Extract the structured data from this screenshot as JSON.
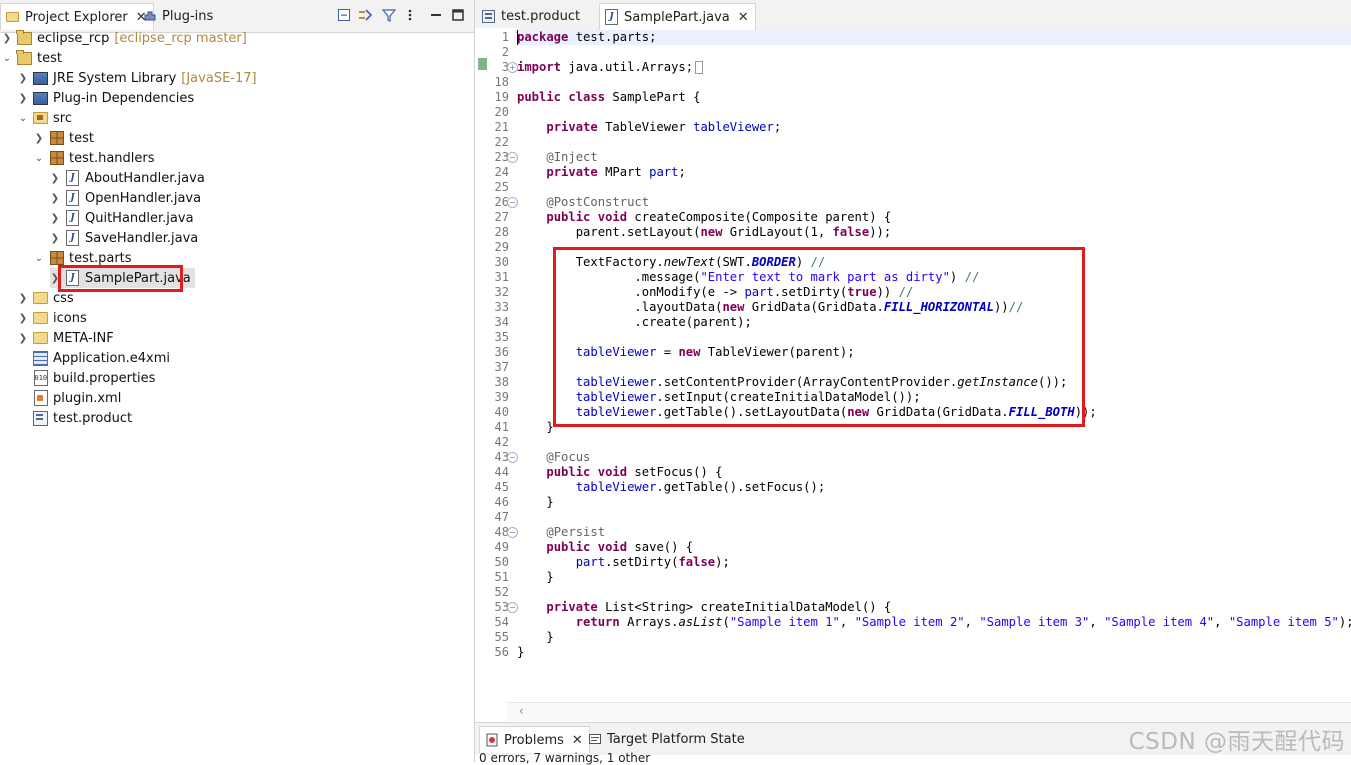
{
  "left_view": {
    "tabs": [
      {
        "label": "Project Explorer",
        "close": "✕"
      },
      {
        "label": "Plug-ins"
      }
    ],
    "toolbar_icons": [
      "collapse-all-icon",
      "link-with-editor-icon",
      "filter-icon",
      "view-menu-icon",
      "minimize-icon",
      "maximize-icon"
    ],
    "tree": [
      {
        "label": "eclipse_rcp",
        "deco": "[eclipse_rcp master]"
      },
      {
        "label": "test"
      },
      {
        "label": "JRE System Library",
        "deco": "[JavaSE-17]"
      },
      {
        "label": "Plug-in Dependencies"
      },
      {
        "label": "src"
      },
      {
        "label": "test"
      },
      {
        "label": "test.handlers"
      },
      {
        "label": "AboutHandler.java"
      },
      {
        "label": "OpenHandler.java"
      },
      {
        "label": "QuitHandler.java"
      },
      {
        "label": "SaveHandler.java"
      },
      {
        "label": "test.parts"
      },
      {
        "label": "SamplePart.java"
      },
      {
        "label": "css"
      },
      {
        "label": "icons"
      },
      {
        "label": "META-INF"
      },
      {
        "label": "Application.e4xmi"
      },
      {
        "label": "build.properties"
      },
      {
        "label": "plugin.xml"
      },
      {
        "label": "test.product"
      }
    ]
  },
  "editor": {
    "tabs": [
      {
        "label": "test.product"
      },
      {
        "label": "SamplePart.java",
        "close": "✕"
      }
    ],
    "line_numbers": [
      "1",
      "2",
      "3",
      "18",
      "19",
      "20",
      "21",
      "22",
      "23",
      "24",
      "25",
      "26",
      "27",
      "28",
      "29",
      "30",
      "31",
      "32",
      "33",
      "34",
      "35",
      "36",
      "37",
      "38",
      "39",
      "40",
      "41",
      "42",
      "43",
      "44",
      "45",
      "46",
      "47",
      "48",
      "49",
      "50",
      "51",
      "52",
      "53",
      "54",
      "55",
      "56"
    ],
    "code": [
      [
        "package test.parts;"
      ],
      [
        ""
      ],
      [
        "import java.util.Arrays;"
      ],
      [
        ""
      ],
      [
        "public class SamplePart {"
      ],
      [
        ""
      ],
      [
        "    private TableViewer tableViewer;"
      ],
      [
        ""
      ],
      [
        "    @Inject"
      ],
      [
        "    private MPart part;"
      ],
      [
        ""
      ],
      [
        "    @PostConstruct"
      ],
      [
        "    public void createComposite(Composite parent) {"
      ],
      [
        "        parent.setLayout(new GridLayout(1, false));"
      ],
      [
        ""
      ],
      [
        "        TextFactory.newText(SWT.BORDER) //"
      ],
      [
        "                .message(\"Enter text to mark part as dirty\") //"
      ],
      [
        "                .onModify(e -> part.setDirty(true)) //"
      ],
      [
        "                .layoutData(new GridData(GridData.FILL_HORIZONTAL))//"
      ],
      [
        "                .create(parent);"
      ],
      [
        ""
      ],
      [
        "        tableViewer = new TableViewer(parent);"
      ],
      [
        ""
      ],
      [
        "        tableViewer.setContentProvider(ArrayContentProvider.getInstance());"
      ],
      [
        "        tableViewer.setInput(createInitialDataModel());"
      ],
      [
        "        tableViewer.getTable().setLayoutData(new GridData(GridData.FILL_BOTH));"
      ],
      [
        "    }"
      ],
      [
        ""
      ],
      [
        "    @Focus"
      ],
      [
        "    public void setFocus() {"
      ],
      [
        "        tableViewer.getTable().setFocus();"
      ],
      [
        "    }"
      ],
      [
        ""
      ],
      [
        "    @Persist"
      ],
      [
        "    public void save() {"
      ],
      [
        "        part.setDirty(false);"
      ],
      [
        "    }"
      ],
      [
        ""
      ],
      [
        "    private List<String> createInitialDataModel() {"
      ],
      [
        "        return Arrays.asList(\"Sample item 1\", \"Sample item 2\", \"Sample item 3\", \"Sample item 4\", \"Sample item 5\");"
      ],
      [
        "    }"
      ],
      [
        "}"
      ]
    ]
  },
  "bottom_panel": {
    "tabs": [
      {
        "label": "Problems",
        "close": "✕"
      },
      {
        "label": "Target Platform State"
      }
    ],
    "status": "0 errors, 7 warnings, 1 other"
  },
  "watermark": "CSDN @雨天酲代码",
  "colors": {
    "highlight_border": "#e21c1c",
    "keyword": "#7f0055",
    "string": "#2a00ff",
    "field": "#0000c0",
    "annotation": "#646464"
  }
}
